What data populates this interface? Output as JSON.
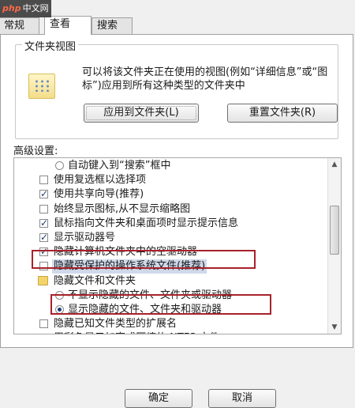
{
  "watermark": {
    "brand": "php",
    "site": "中文网"
  },
  "tabs": [
    {
      "label": "常规"
    },
    {
      "label": "查看"
    },
    {
      "label": "搜索"
    }
  ],
  "folder_views": {
    "legend": "文件夹视图",
    "description": "可以将该文件夹正在使用的视图(例如“详细信息”或“图标”)应用到所有这种类型的文件夹中",
    "apply_label": "应用到文件夹(L)",
    "reset_label": "重置文件夹(R)"
  },
  "advanced": {
    "label": "高级设置:",
    "rows": [
      {
        "kind": "radio",
        "checked": false,
        "label": "自动键入到“搜索”框中"
      },
      {
        "kind": "check",
        "checked": false,
        "label": "使用复选框以选择项"
      },
      {
        "kind": "check",
        "checked": true,
        "label": "使用共享向导(推荐)"
      },
      {
        "kind": "check",
        "checked": false,
        "label": "始终显示图标,从不显示缩略图"
      },
      {
        "kind": "check",
        "checked": true,
        "label": "鼠标指向文件夹和桌面项时显示提示信息"
      },
      {
        "kind": "check",
        "checked": true,
        "label": "显示驱动器号"
      },
      {
        "kind": "check",
        "checked": true,
        "label": "隐藏计算机文件夹中的空驱动器"
      },
      {
        "kind": "check",
        "checked": false,
        "label": "隐藏受保护的操作系统文件(推荐)"
      },
      {
        "kind": "folder",
        "checked": false,
        "label": "隐藏文件和文件夹"
      },
      {
        "kind": "radio",
        "checked": false,
        "label": "不显示隐藏的文件、文件夹或驱动器"
      },
      {
        "kind": "radio",
        "checked": true,
        "label": "显示隐藏的文件、文件夹和驱动器"
      },
      {
        "kind": "check",
        "checked": false,
        "label": "隐藏已知文件类型的扩展名"
      },
      {
        "kind": "check",
        "checked": true,
        "label": "用彩色显示加密或压缩的 NTFS 文件"
      }
    ]
  },
  "footer": {
    "ok_label": "确定",
    "cancel_label": "取消"
  }
}
